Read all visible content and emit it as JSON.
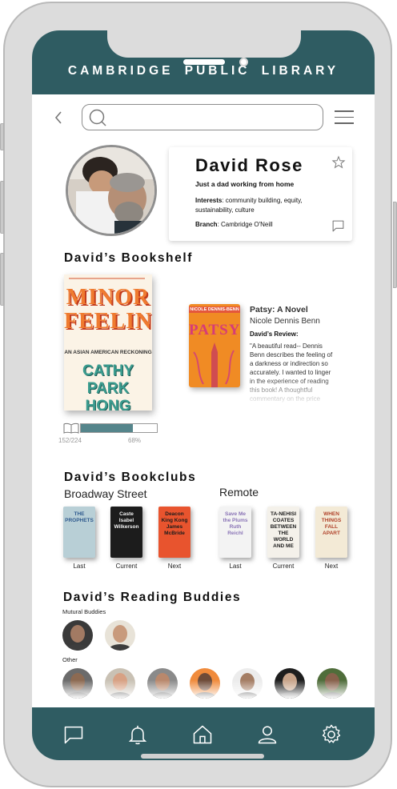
{
  "app": {
    "title": "CAMBRIDGE PUBLIC LIBRARY"
  },
  "search": {
    "value": ""
  },
  "profile": {
    "name": "David Rose",
    "tagline": "Just a dad working from home",
    "interests_label": "Interests",
    "interests": ": community building, equity,  sustainability, culture",
    "branch_label": "Branch",
    "branch": ": Cambridge O'Neill"
  },
  "bookshelf": {
    "title": "David’s Bookshelf",
    "current_book": {
      "cover_title": "MINOR FEELINGS",
      "cover_subtitle": "AN ASIAN AMERICAN RECKONING",
      "cover_author": "CATHY PARK HONG",
      "pages": "152/224",
      "percent_label": "68%",
      "progress": 0.68
    },
    "featured": {
      "cover_author": "NICOLE DENNIS-BENN",
      "cover_title": "PATSY",
      "title": "Patsy: A Novel",
      "author": "Nicole Dennis Benn",
      "review_label": "David’s Review:",
      "review": "\"A beautiful read-- Dennis Benn describes the feeling of a darkness or indirection so accurately. I wanted to linger in the experience of reading this book! A thoughtful commentary on the price"
    }
  },
  "bookclubs": {
    "title": "David’s Bookclubs",
    "clubs": [
      {
        "name": "Broadway Street",
        "books": [
          {
            "cover": "THE PROPHETS",
            "label": "Last",
            "bg": "#b8cfd6",
            "fg": "#2f5a8e"
          },
          {
            "cover": "Caste Isabel Wilkerson",
            "label": "Current",
            "bg": "#1c1c1c",
            "fg": "#f2f2f2"
          },
          {
            "cover": "Deacon King Kong James McBride",
            "label": "Next",
            "bg": "#e8542e",
            "fg": "#1b1b1b"
          }
        ]
      },
      {
        "name": "Remote",
        "books": [
          {
            "cover": "Save Me the Plums Ruth Reichl",
            "label": "Last",
            "bg": "#f3f3f3",
            "fg": "#8a74b6"
          },
          {
            "cover": "TA-NEHISI COATES BETWEEN THE WORLD AND ME",
            "label": "Current",
            "bg": "#f4f1ea",
            "fg": "#1b1b1b"
          },
          {
            "cover": "WHEN THINGS FALL APART",
            "label": "Next",
            "bg": "#f3ead6",
            "fg": "#b0422a"
          }
        ]
      }
    ]
  },
  "buddies": {
    "title": "David’s Reading Buddies",
    "mutual_label": "Mutural Buddies",
    "other_label": "Other",
    "mutual_count": 2,
    "other_count": 7
  },
  "nav": {
    "items": [
      "chat-icon",
      "bell-icon",
      "home-icon",
      "user-icon",
      "gear-icon"
    ]
  },
  "colors": {
    "brand": "#2f5c62",
    "progress": "#55858b"
  }
}
